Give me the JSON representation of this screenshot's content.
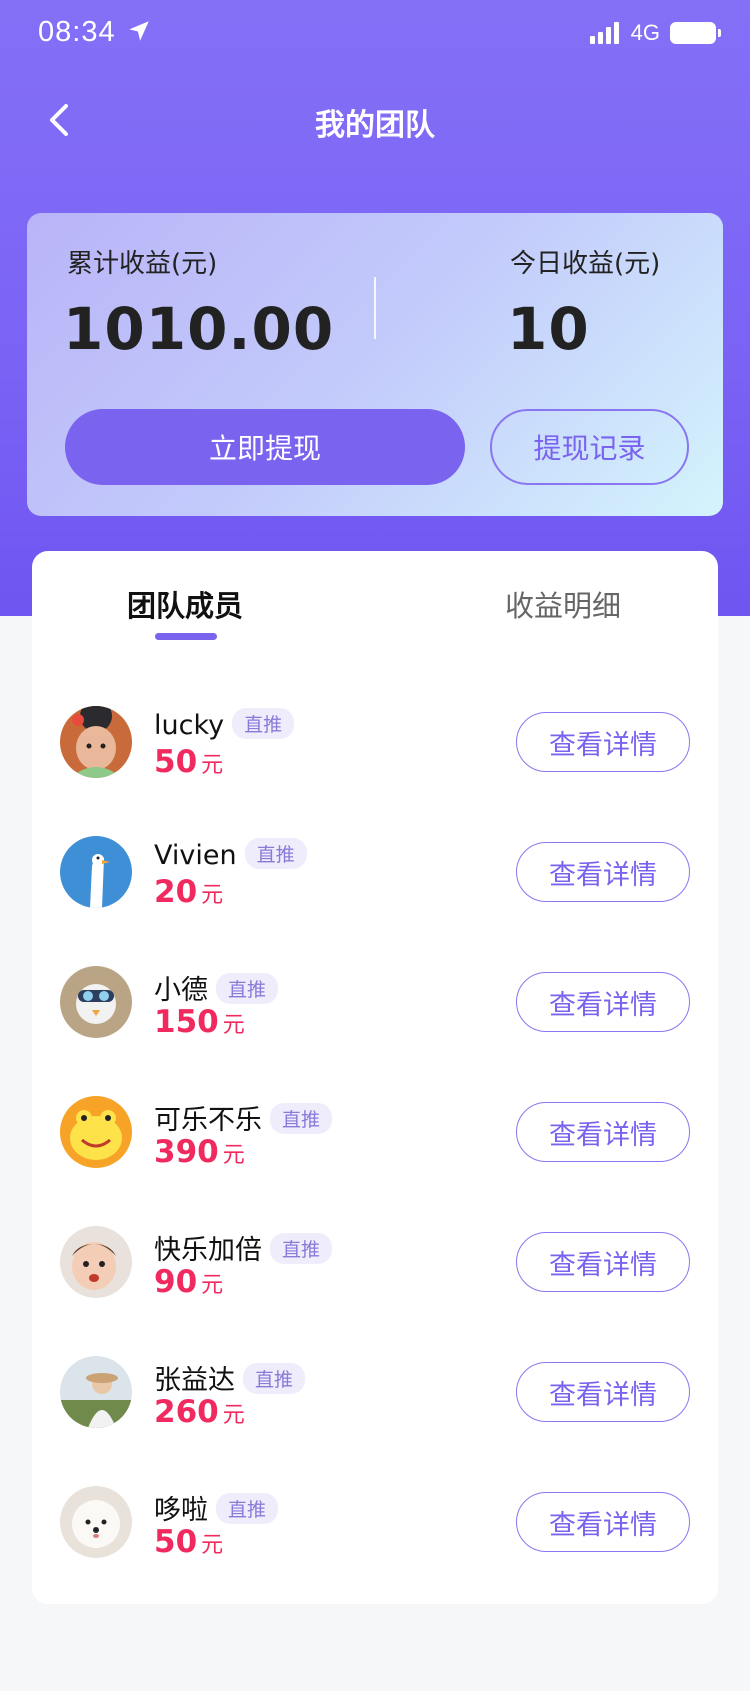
{
  "status_bar": {
    "time": "08:34",
    "network": "4G"
  },
  "nav": {
    "title": "我的团队"
  },
  "earnings": {
    "total_label": "累计收益(元)",
    "total_value": "1010.00",
    "today_label": "今日收益(元)",
    "today_value": "10",
    "withdraw_label": "立即提现",
    "record_label": "提现记录"
  },
  "tabs": [
    {
      "label": "团队成员",
      "active": true
    },
    {
      "label": "收益明细",
      "active": false
    }
  ],
  "members": [
    {
      "name": "lucky",
      "tag": "直推",
      "amount": "50",
      "unit": "元",
      "action": "查看详情"
    },
    {
      "name": "Vivien",
      "tag": "直推",
      "amount": "20",
      "unit": "元",
      "action": "查看详情"
    },
    {
      "name": "小德",
      "tag": "直推",
      "amount": "150",
      "unit": "元",
      "action": "查看详情"
    },
    {
      "name": "可乐不乐",
      "tag": "直推",
      "amount": "390",
      "unit": "元",
      "action": "查看详情"
    },
    {
      "name": "快乐加倍",
      "tag": "直推",
      "amount": "90",
      "unit": "元",
      "action": "查看详情"
    },
    {
      "name": "张益达",
      "tag": "直推",
      "amount": "260",
      "unit": "元",
      "action": "查看详情"
    },
    {
      "name": "哆啦",
      "tag": "直推",
      "amount": "50",
      "unit": "元",
      "action": "查看详情"
    }
  ],
  "colors": {
    "brand": "#7a63ef",
    "amount": "#f02a5e",
    "tag_bg": "#efedfc"
  }
}
